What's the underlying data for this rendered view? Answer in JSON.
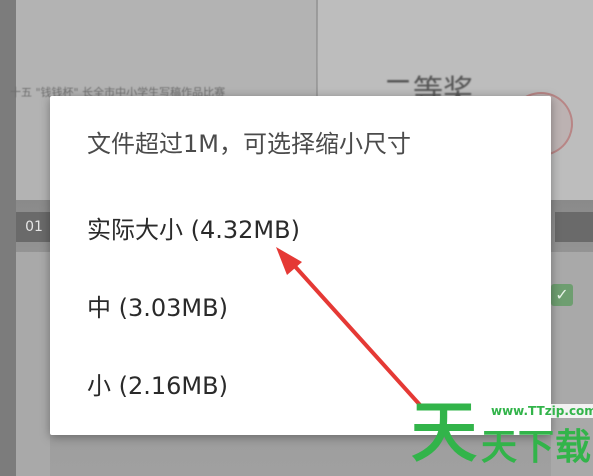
{
  "dialog": {
    "title": "文件超过1M，可选择缩小尺寸",
    "options": [
      {
        "label": "实际大小 (4.32MB)"
      },
      {
        "label": "中 (3.03MB)"
      },
      {
        "label": "小 (2.16MB)"
      }
    ]
  },
  "background": {
    "page_indicator": "01",
    "big_title": "二等奖"
  },
  "watermark": {
    "big_char": "天",
    "url": "www.TTzip.com",
    "sub_text": "天下载"
  },
  "colors": {
    "annotation_arrow": "#e53935",
    "watermark_green": "#32b44a",
    "overlay_dim": "#8f8f8f"
  },
  "icons": {
    "checkbox": "check-icon",
    "annotation": "red-arrow-annotation"
  }
}
